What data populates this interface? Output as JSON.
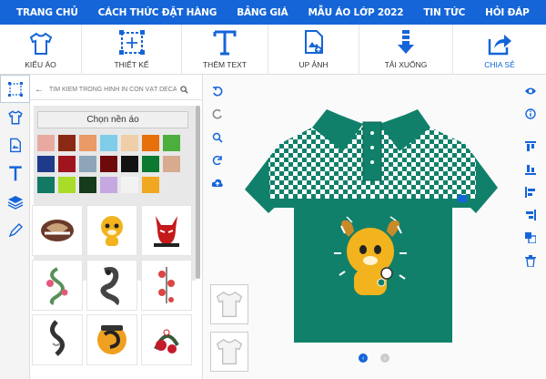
{
  "nav": {
    "items": [
      "TRANG CHỦ",
      "CÁCH THỨC ĐẶT HÀNG",
      "BẢNG GIÁ",
      "MẪU ÁO LỚP 2022",
      "TIN TỨC",
      "HỎI ĐÁP"
    ]
  },
  "toolbar": {
    "items": [
      {
        "label": "KIỂU ÁO",
        "icon": "shirt-icon"
      },
      {
        "label": "THIẾT KẾ",
        "icon": "design-move-icon"
      },
      {
        "label": "THÊM TEXT",
        "icon": "text-T-icon"
      },
      {
        "label": "UP ẢNH",
        "icon": "upload-image-icon"
      },
      {
        "label": "TẢI XUỐNG",
        "icon": "download-arrow-icon"
      },
      {
        "label": "CHIA SẺ",
        "icon": "share-icon"
      }
    ]
  },
  "search": {
    "placeholder": "TÌM KIẾM TRONG HÌNH IN CON VẬT DECAL"
  },
  "panel": {
    "bg_button": "Chọn nền áo",
    "swatches": [
      "#e8aaa0",
      "#8a2a14",
      "#e99a66",
      "#7fcde8",
      "#f0cfa8",
      "#e8700a",
      "#4cae3c",
      "#1f3a8a",
      "#a0141e",
      "#8ea5b8",
      "#6e0a0a",
      "#121212",
      "#0b7a30",
      "#d8ab8e",
      "#127a64",
      "#a8dc28",
      "#163a1c",
      "#c5a8e0",
      "#f2f2f2",
      "#f0a820"
    ]
  },
  "colors": {
    "accent": "#1565d8",
    "shirt": "#10806a"
  }
}
